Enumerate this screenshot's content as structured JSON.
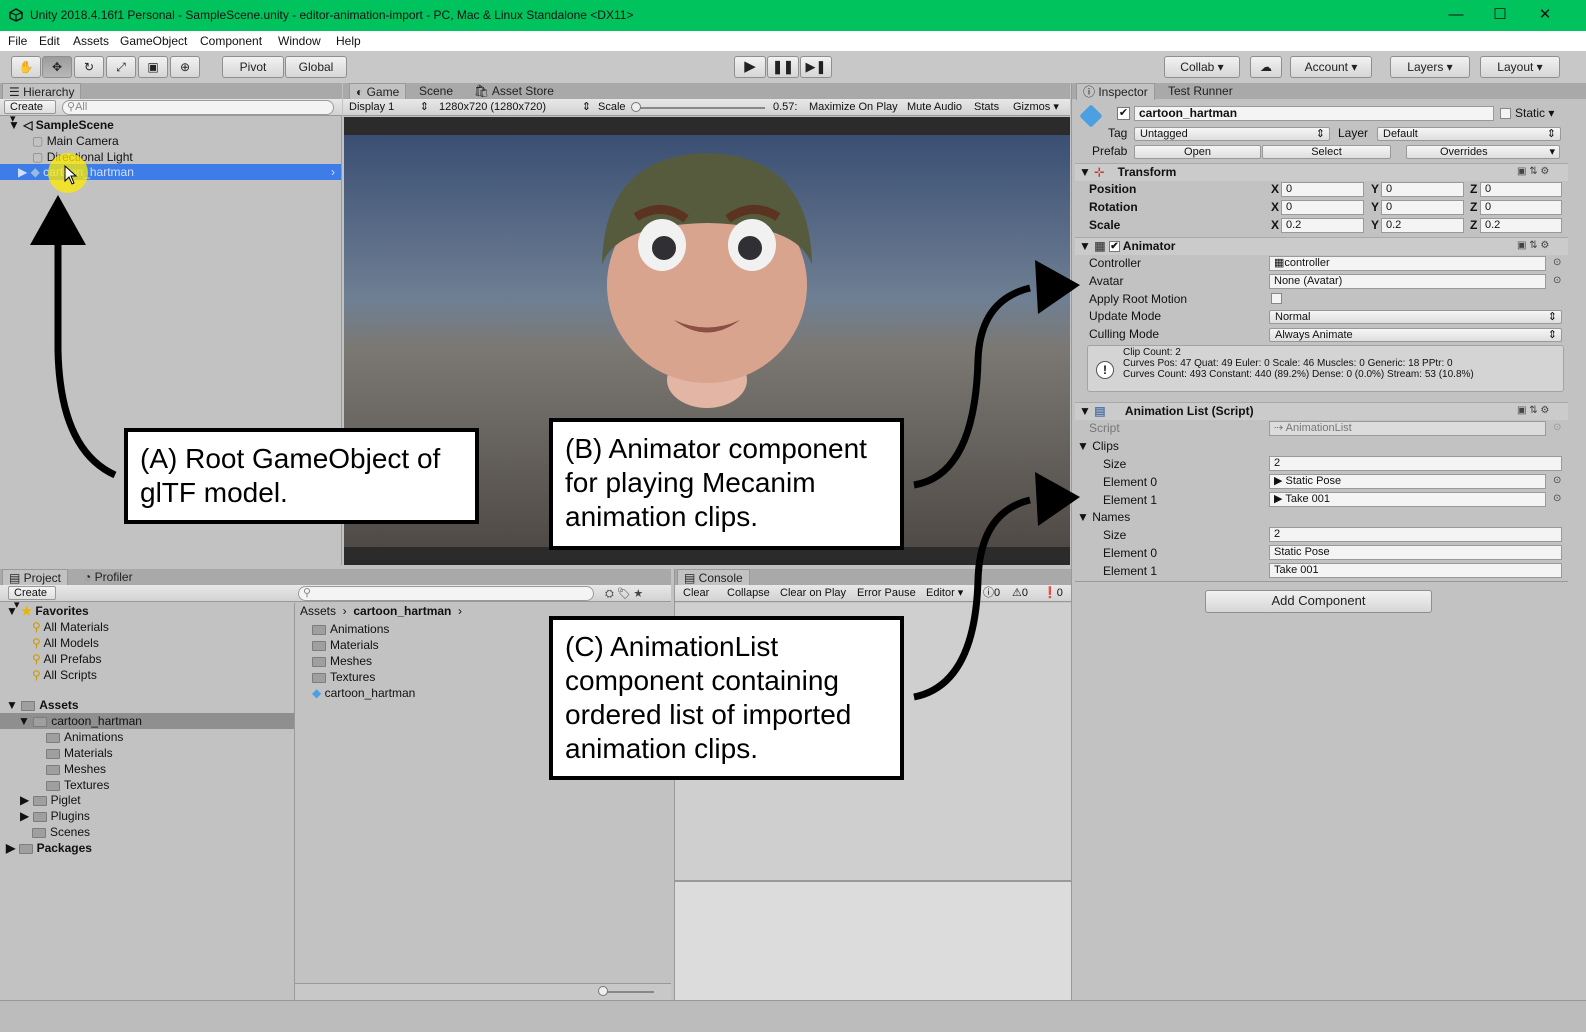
{
  "window": {
    "title": "Unity 2018.4.16f1 Personal - SampleScene.unity - editor-animation-import - PC, Mac & Linux Standalone <DX11>",
    "minimize": "—",
    "maximize": "☐",
    "close": "✕"
  },
  "menu": [
    "File",
    "Edit",
    "Assets",
    "GameObject",
    "Component",
    "Window",
    "Help"
  ],
  "toolbar": {
    "pivot": "Pivot",
    "global": "Global",
    "collab": "Collab",
    "account": "Account",
    "layers": "Layers",
    "layout": "Layout"
  },
  "hierarchy": {
    "tab": "Hierarchy",
    "create": "Create",
    "search_placeholder": "All",
    "scene": "SampleScene",
    "items": [
      "Main Camera",
      "Directional Light",
      "cartoon_hartman"
    ]
  },
  "game": {
    "tabs": [
      "Game",
      "Scene",
      "Asset Store"
    ],
    "display": "Display 1",
    "resolution": "1280x720 (1280x720)",
    "scale_label": "Scale",
    "scale_value": "0.57:",
    "buttons": [
      "Maximize On Play",
      "Mute Audio",
      "Stats",
      "Gizmos"
    ]
  },
  "inspector": {
    "tabs": [
      "Inspector",
      "Test Runner"
    ],
    "name": "cartoon_hartman",
    "static": "Static",
    "tag_label": "Tag",
    "tag": "Untagged",
    "layer_label": "Layer",
    "layer": "Default",
    "prefab_label": "Prefab",
    "prefab_open": "Open",
    "prefab_select": "Select",
    "prefab_overrides": "Overrides",
    "transform": {
      "title": "Transform",
      "rows": [
        {
          "label": "Position",
          "x": "0",
          "y": "0",
          "z": "0"
        },
        {
          "label": "Rotation",
          "x": "0",
          "y": "0",
          "z": "0"
        },
        {
          "label": "Scale",
          "x": "0.2",
          "y": "0.2",
          "z": "0.2"
        }
      ]
    },
    "animator": {
      "title": "Animator",
      "controller_label": "Controller",
      "controller": "controller",
      "avatar_label": "Avatar",
      "avatar": "None (Avatar)",
      "root_motion_label": "Apply Root Motion",
      "update_label": "Update Mode",
      "update": "Normal",
      "culling_label": "Culling Mode",
      "culling": "Always Animate",
      "info": [
        "Clip Count: 2",
        "Curves Pos: 47 Quat: 49 Euler: 0 Scale: 46 Muscles: 0 Generic: 18 PPtr: 0",
        "Curves Count: 493 Constant: 440 (89.2%) Dense: 0 (0.0%) Stream: 53 (10.8%)"
      ]
    },
    "animlist": {
      "title": "Animation List (Script)",
      "script_label": "Script",
      "script": "AnimationList",
      "clips_label": "Clips",
      "size_label": "Size",
      "clips_size": "2",
      "clips": [
        "Static Pose",
        "Take 001"
      ],
      "names_label": "Names",
      "names_size": "2",
      "names": [
        "Static Pose",
        "Take 001"
      ],
      "element0": "Element 0",
      "element1": "Element 1"
    },
    "add_component": "Add Component"
  },
  "project": {
    "tabs": [
      "Project",
      "Profiler"
    ],
    "create": "Create",
    "favorites": "Favorites",
    "fav_items": [
      "All Materials",
      "All Models",
      "All Prefabs",
      "All Scripts"
    ],
    "assets": "Assets",
    "tree": [
      "cartoon_hartman",
      "Animations",
      "Materials",
      "Meshes",
      "Textures",
      "Piglet",
      "Plugins",
      "Scenes"
    ],
    "packages": "Packages",
    "breadcrumb": [
      "Assets",
      "cartoon_hartman"
    ],
    "files": [
      "Animations",
      "Materials",
      "Meshes",
      "Textures",
      "cartoon_hartman"
    ]
  },
  "console": {
    "tab": "Console",
    "buttons": [
      "Clear",
      "Collapse",
      "Clear on Play",
      "Error Pause",
      "Editor"
    ],
    "counts": [
      "0",
      "0",
      "0"
    ]
  },
  "callouts": {
    "a": "(A) Root GameObject of glTF model.",
    "b": "(B) Animator component for playing Mecanim animation clips.",
    "c": "(C) AnimationList component containing ordered list of imported animation clips."
  },
  "colors": {
    "titlebar": "#00c35d",
    "selection": "#3e7de7",
    "panel": "#c2c2c2"
  }
}
